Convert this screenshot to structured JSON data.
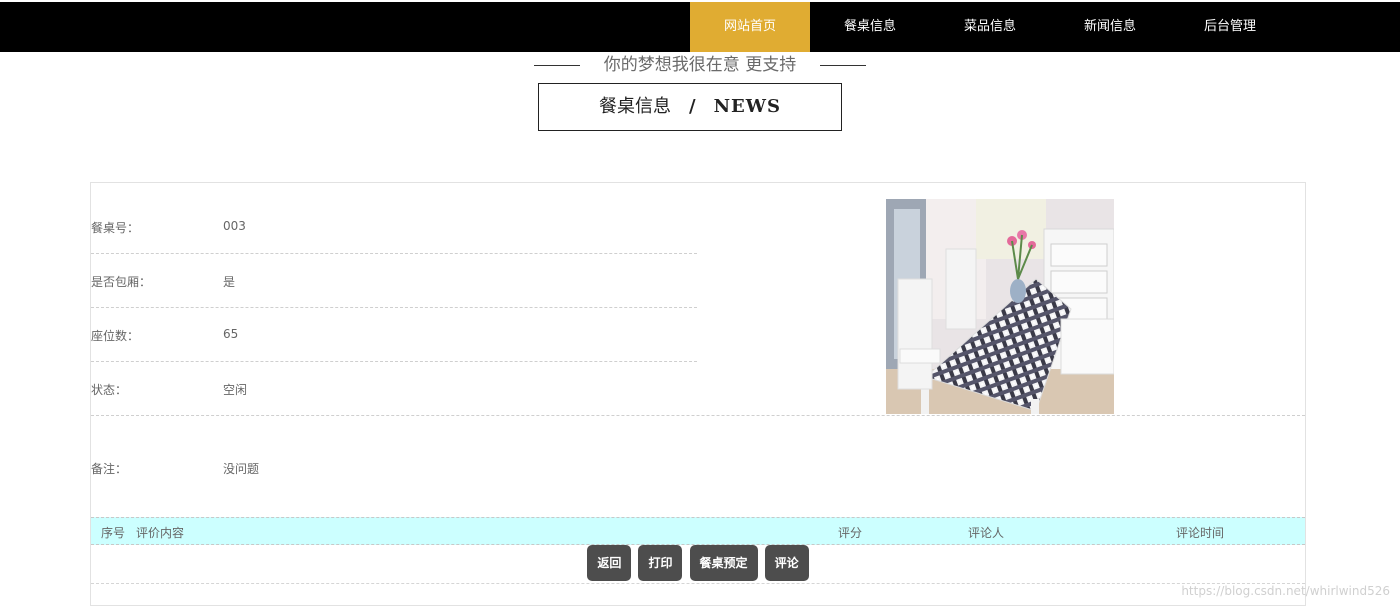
{
  "nav": {
    "items": [
      {
        "label": "网站首页",
        "active": true
      },
      {
        "label": "餐桌信息",
        "active": false
      },
      {
        "label": "菜品信息",
        "active": false
      },
      {
        "label": "新闻信息",
        "active": false
      },
      {
        "label": "后台管理",
        "active": false
      }
    ]
  },
  "slogan": "你的梦想我很在意 更支持",
  "section_title": {
    "cn": "餐桌信息",
    "separator": "/",
    "en": "NEWS"
  },
  "detail": {
    "table_no": {
      "label": "餐桌号：",
      "value": "003"
    },
    "private_room": {
      "label": "是否包厢：",
      "value": "是"
    },
    "seats": {
      "label": "座位数：",
      "value": "65"
    },
    "status": {
      "label": "状态：",
      "value": "空闲"
    },
    "remark": {
      "label": "备注：",
      "value": "没问题"
    }
  },
  "comments": {
    "columns": [
      "序号",
      "评价内容",
      "评分",
      "评论人",
      "评论时间"
    ]
  },
  "buttons": {
    "back": "返回",
    "print": "打印",
    "reserve": "餐桌预定",
    "comment": "评论"
  },
  "watermark": "https://blog.csdn.net/whirlwind526",
  "colors": {
    "nav_bg": "#000000",
    "nav_active": "#e0ac32",
    "comment_header_bg": "#ccffff",
    "button_bg": "#4d4d4d"
  }
}
